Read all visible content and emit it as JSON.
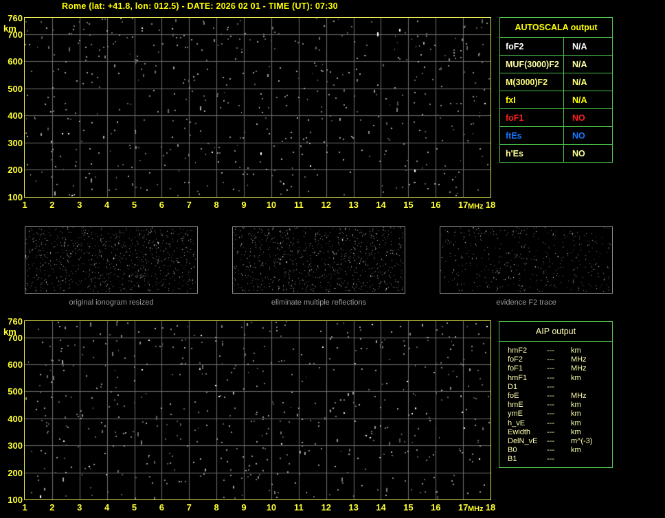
{
  "title": "Rome (lat: +41.8, lon: 012.5) - DATE: 2026 02 01 - TIME (UT): 07:30",
  "top_plot": {
    "y_unit": "km",
    "x_unit": "MHz",
    "y_ticks": [
      "760",
      "700",
      "600",
      "500",
      "400",
      "300",
      "200",
      "100"
    ],
    "x_ticks": [
      "1",
      "2",
      "3",
      "4",
      "5",
      "6",
      "7",
      "8",
      "9",
      "10",
      "11",
      "12",
      "13",
      "14",
      "15",
      "16",
      "17",
      "18"
    ],
    "y_range": [
      100,
      760
    ],
    "x_range": [
      1,
      18
    ]
  },
  "bottom_plot": {
    "y_unit": "km",
    "x_unit": "MHz",
    "y_ticks": [
      "760",
      "700",
      "600",
      "500",
      "400",
      "300",
      "200",
      "100"
    ],
    "x_ticks": [
      "1",
      "2",
      "3",
      "4",
      "5",
      "6",
      "7",
      "8",
      "9",
      "10",
      "11",
      "12",
      "13",
      "14",
      "15",
      "16",
      "17",
      "18"
    ],
    "y_range": [
      100,
      760
    ],
    "x_range": [
      1,
      18
    ]
  },
  "autoscala_table": {
    "header": "AUTOSCALA output",
    "rows": [
      {
        "label": "foF2",
        "value": "N/A",
        "color": "#ffffff"
      },
      {
        "label": "MUF(3000)F2",
        "value": "N/A",
        "color": "#ffffa8"
      },
      {
        "label": "M(3000)F2",
        "value": "N/A",
        "color": "#ffff78"
      },
      {
        "label": "fxI",
        "value": "N/A",
        "color": "#ffff00"
      },
      {
        "label": "foF1",
        "value": "NO",
        "color": "#ff1f1f"
      },
      {
        "label": "ftEs",
        "value": "NO",
        "color": "#1478ff"
      },
      {
        "label": "h'Es",
        "value": "NO",
        "color": "#ffff98"
      }
    ]
  },
  "panels": [
    {
      "caption": "original ionogram resized"
    },
    {
      "caption": "eliminate multiple reflections"
    },
    {
      "caption": "evidence F2 trace"
    }
  ],
  "aip_table": {
    "header": "AIP output",
    "rows": [
      {
        "param": "hmF2",
        "value": "---",
        "unit": "km"
      },
      {
        "param": "foF2",
        "value": "---",
        "unit": "MHz"
      },
      {
        "param": "foF1",
        "value": "---",
        "unit": "MHz"
      },
      {
        "param": "hmF1",
        "value": "---",
        "unit": "km"
      },
      {
        "param": "D1",
        "value": "---",
        "unit": ""
      },
      {
        "param": "foE",
        "value": "---",
        "unit": "MHz"
      },
      {
        "param": "hmE",
        "value": "---",
        "unit": "km"
      },
      {
        "param": "ymE",
        "value": "---",
        "unit": "km"
      },
      {
        "param": "h_vE",
        "value": "---",
        "unit": "km"
      },
      {
        "param": "Ewidth",
        "value": "---",
        "unit": "km"
      },
      {
        "param": "DelN_vE",
        "value": "---",
        "unit": "m^(-3)"
      },
      {
        "param": "B0",
        "value": "---",
        "unit": "km"
      },
      {
        "param": "B1",
        "value": "---",
        "unit": ""
      }
    ]
  },
  "colors": {
    "background": "#000000",
    "accent_yellow": "#ffff00",
    "axis_yellow": "#e8e850",
    "table_green": "#4ec94e",
    "grid_gray": "#6f6f6f",
    "panel_border_gray": "#8a8a8a",
    "caption_gray": "#9a9a9a",
    "aip_text": "#ffffb0"
  }
}
